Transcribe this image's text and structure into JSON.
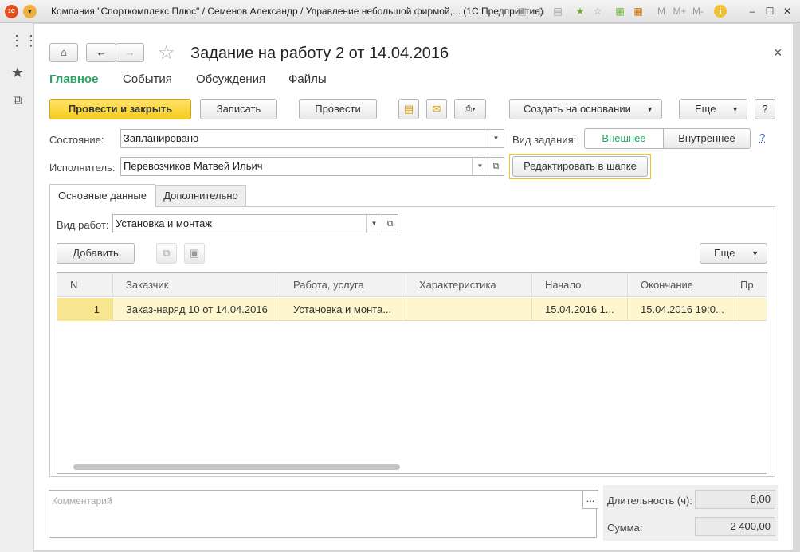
{
  "titlebar": {
    "title": "Компания \"Спорткомплекс Плюс\" / Семенов Александр / Управление небольшой фирмой,... (1С:Предприятие)",
    "m": "M",
    "mplus": "M+",
    "mminus": "M-"
  },
  "form": {
    "title": "Задание на работу 2 от 14.04.2016",
    "close": "×"
  },
  "nav_tabs": [
    "Главное",
    "События",
    "Обсуждения",
    "Файлы"
  ],
  "toolbar": {
    "post_close": "Провести и закрыть",
    "save": "Записать",
    "post": "Провести",
    "create_based": "Создать на основании",
    "more": "Еще",
    "help": "?"
  },
  "fields": {
    "state_label": "Состояние:",
    "state_value": "Запланировано",
    "task_type_label": "Вид задания:",
    "task_type_external": "Внешнее",
    "task_type_internal": "Внутреннее",
    "task_type_help": "?",
    "executor_label": "Исполнитель:",
    "executor_value": "Перевозчиков Матвей Ильич",
    "edit_header": "Редактировать в шапке"
  },
  "inner_tabs": [
    "Основные данные",
    "Дополнительно"
  ],
  "work": {
    "label": "Вид работ:",
    "value": "Установка и монтаж",
    "add": "Добавить",
    "more": "Еще"
  },
  "table": {
    "columns": [
      "N",
      "Заказчик",
      "Работа, услуга",
      "Характеристика",
      "Начало",
      "Окончание",
      "Пр"
    ],
    "rows": [
      [
        "1",
        "Заказ-наряд 10 от 14.04.2016",
        "Установка и монта...",
        "",
        "15.04.2016 1...",
        "15.04.2016 19:0...",
        ""
      ]
    ]
  },
  "comment": {
    "placeholder": "Комментарий",
    "button": "..."
  },
  "totals": {
    "duration_label": "Длительность (ч):",
    "duration_value": "8,00",
    "sum_label": "Сумма:",
    "sum_value": "2 400,00"
  },
  "colors": {
    "accent_green": "#2aa562",
    "primary_yellow": "#f7cc1c",
    "row_highlight": "#fdf6cf"
  }
}
